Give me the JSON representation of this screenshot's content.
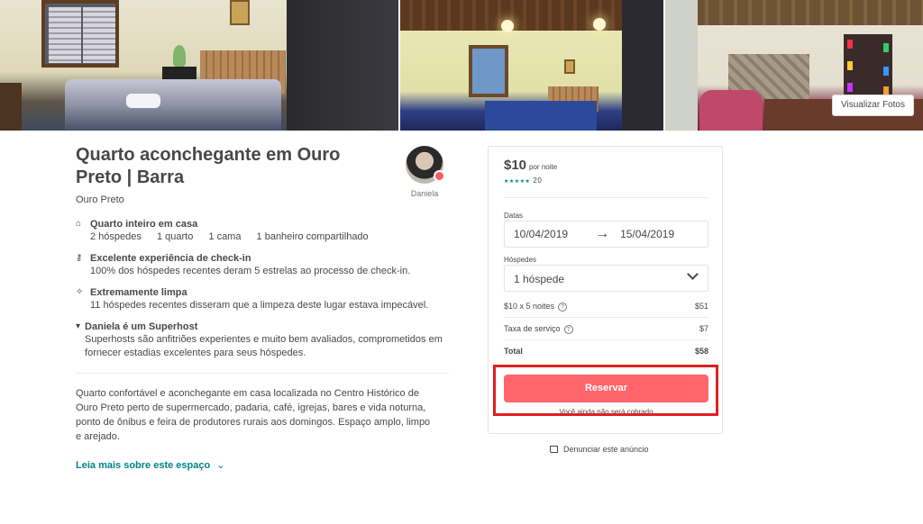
{
  "photos": {
    "view_button": "Visualizar Fotos"
  },
  "listing": {
    "title": "Quarto aconchegante em Ouro Preto | Barra",
    "city": "Ouro Preto",
    "host_name": "Daniela",
    "features": [
      {
        "icon": "home-icon",
        "heading": "Quarto inteiro em casa",
        "details": [
          "2 hóspedes",
          "1 quarto",
          "1 cama",
          "1 banheiro compartilhado"
        ]
      },
      {
        "icon": "key-icon",
        "heading": "Excelente experiência de check-in",
        "description": "100% dos hóspedes recentes deram 5 estrelas ao processo de check-in."
      },
      {
        "icon": "sparkle-icon",
        "heading": "Extremamente limpa",
        "description": "11 hóspedes recentes disseram que a limpeza deste lugar estava impecável."
      },
      {
        "icon": "medal-icon",
        "heading": "Daniela é um Superhost",
        "description": "Superhosts são anfitriões experientes e muito bem avaliados, comprometidos em fornecer estadias excelentes para seus hóspedes."
      }
    ],
    "description": "Quarto confortável e aconchegante em casa localizada no Centro Histórico de Ouro Preto perto de supermercado, padaria, café, igrejas, bares e vida noturna, ponto de ônibus e feira de produtores rurais aos domingos. Espaço amplo, limpo e arejado.",
    "read_more": "Leia mais sobre este espaço"
  },
  "booking": {
    "price": "$10",
    "per_night": "por noite",
    "stars": "★★★★★",
    "reviews": "20",
    "dates_label": "Datas",
    "check_in": "10/04/2019",
    "arrow": "→",
    "check_out": "15/04/2019",
    "guests_label": "Hóspedes",
    "guests_value": "1 hóspede",
    "nights_label": "$10 x 5 noites",
    "nights_amount": "$51",
    "service_label": "Taxa de serviço",
    "service_amount": "$7",
    "total_label": "Total",
    "total_amount": "$58",
    "reserve_button": "Reservar",
    "note": "Você ainda não será cobrado"
  },
  "report": "Denunciar este anúncio",
  "colors": {
    "brand": "#FF5A5F",
    "link": "#008489",
    "highlight": "#E02020"
  }
}
